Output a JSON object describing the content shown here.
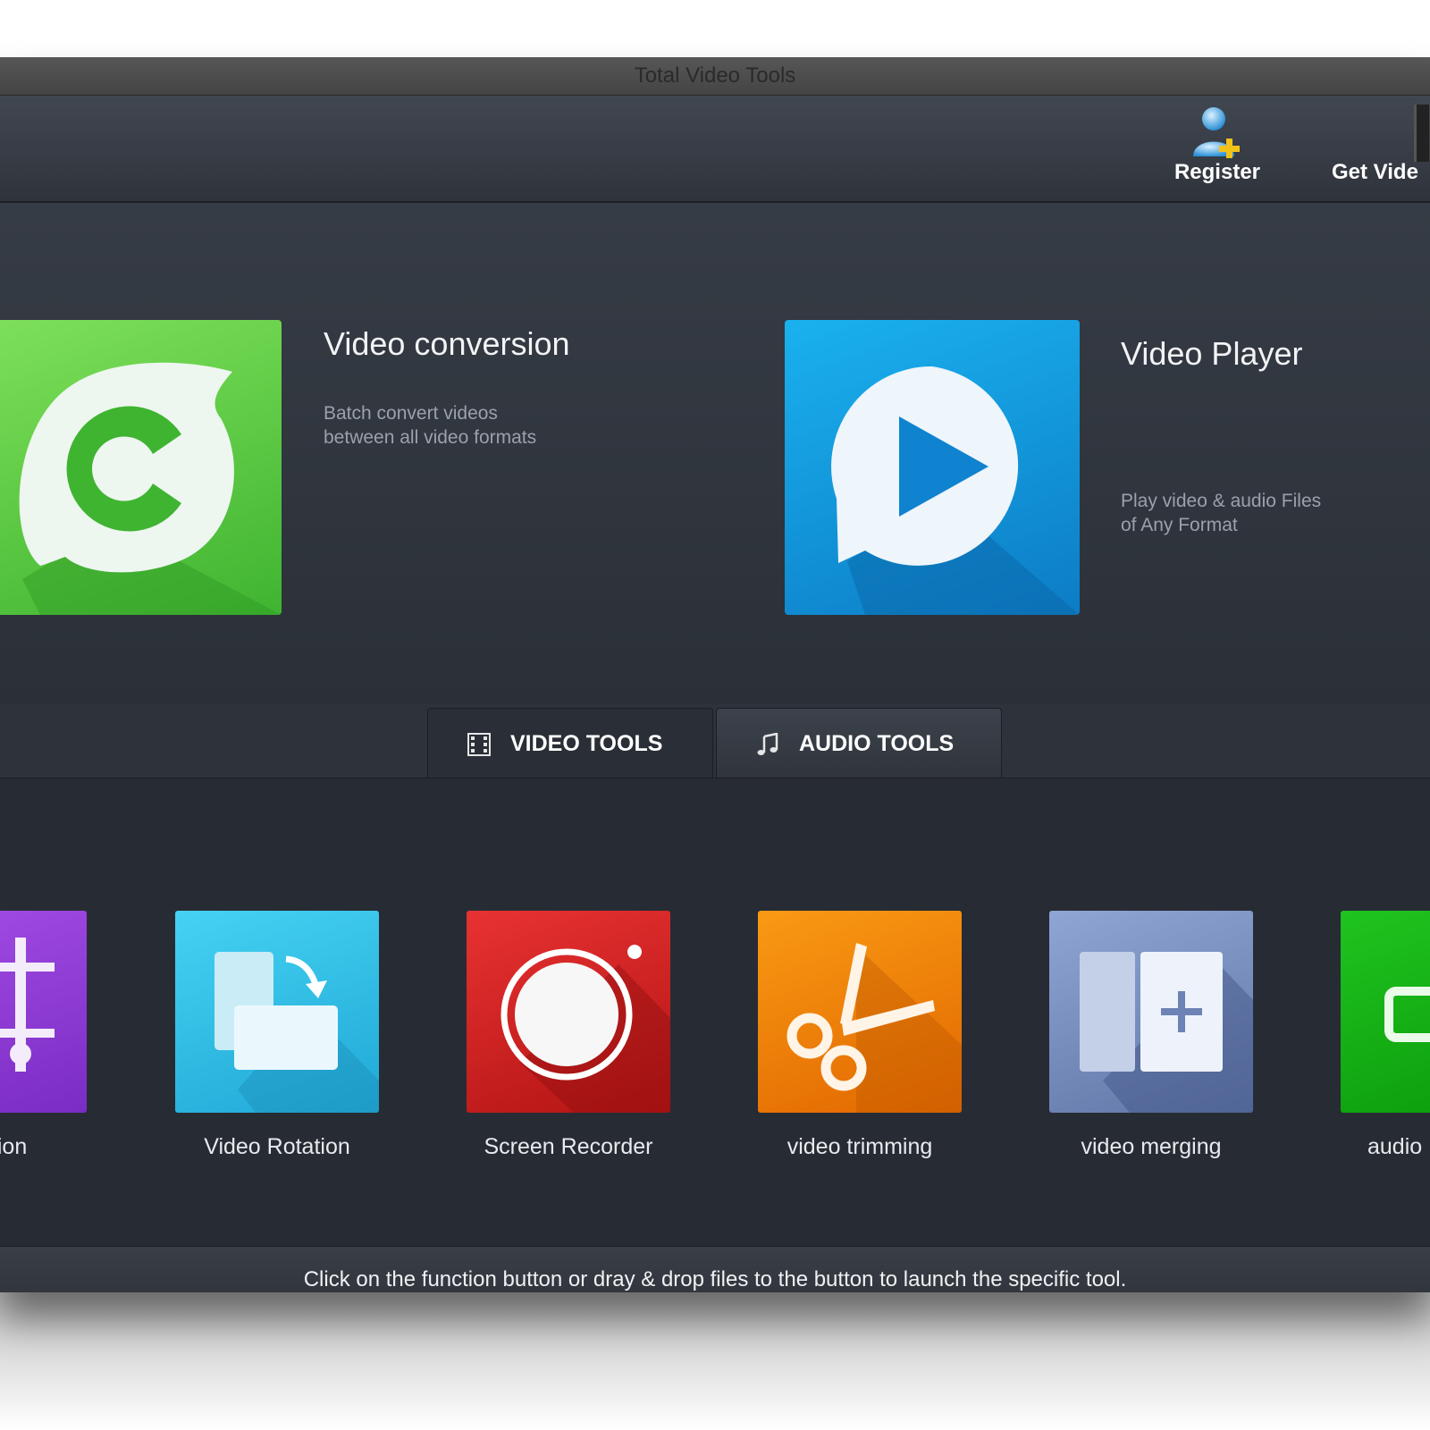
{
  "window": {
    "title": "Total Video Tools"
  },
  "toolbar": {
    "register_label": "Register",
    "get_video_label": "Get Vide"
  },
  "hero": {
    "conversion": {
      "title": "Video conversion",
      "desc_line1": "Batch convert videos",
      "desc_line2": "between all video formats",
      "color": "#4cc23a"
    },
    "player": {
      "title": "Video Player",
      "desc_line1": "Play video & audio Files",
      "desc_line2": "of Any Format",
      "color": "#1193dc"
    }
  },
  "tabs": [
    {
      "label": "VIDEO TOOLS",
      "icon": "film-icon",
      "active": true
    },
    {
      "label": "AUDIO TOOLS",
      "icon": "music-note-icon",
      "active": false
    }
  ],
  "tools": [
    {
      "label": "pression",
      "icon": "compression-icon",
      "color": "#9040d8"
    },
    {
      "label": "Video Rotation",
      "icon": "rotation-icon",
      "color": "#31bde6"
    },
    {
      "label": "Screen Recorder",
      "icon": "record-icon",
      "color": "#d42222"
    },
    {
      "label": "video trimming",
      "icon": "scissors-icon",
      "color": "#f08008"
    },
    {
      "label": "video merging",
      "icon": "merge-icon",
      "color": "#768dbe"
    },
    {
      "label": "audio",
      "icon": "audio-icon",
      "color": "#14b014"
    }
  ],
  "status": {
    "text": "Click on the function button or dray & drop files to the button to launch the specific tool."
  }
}
